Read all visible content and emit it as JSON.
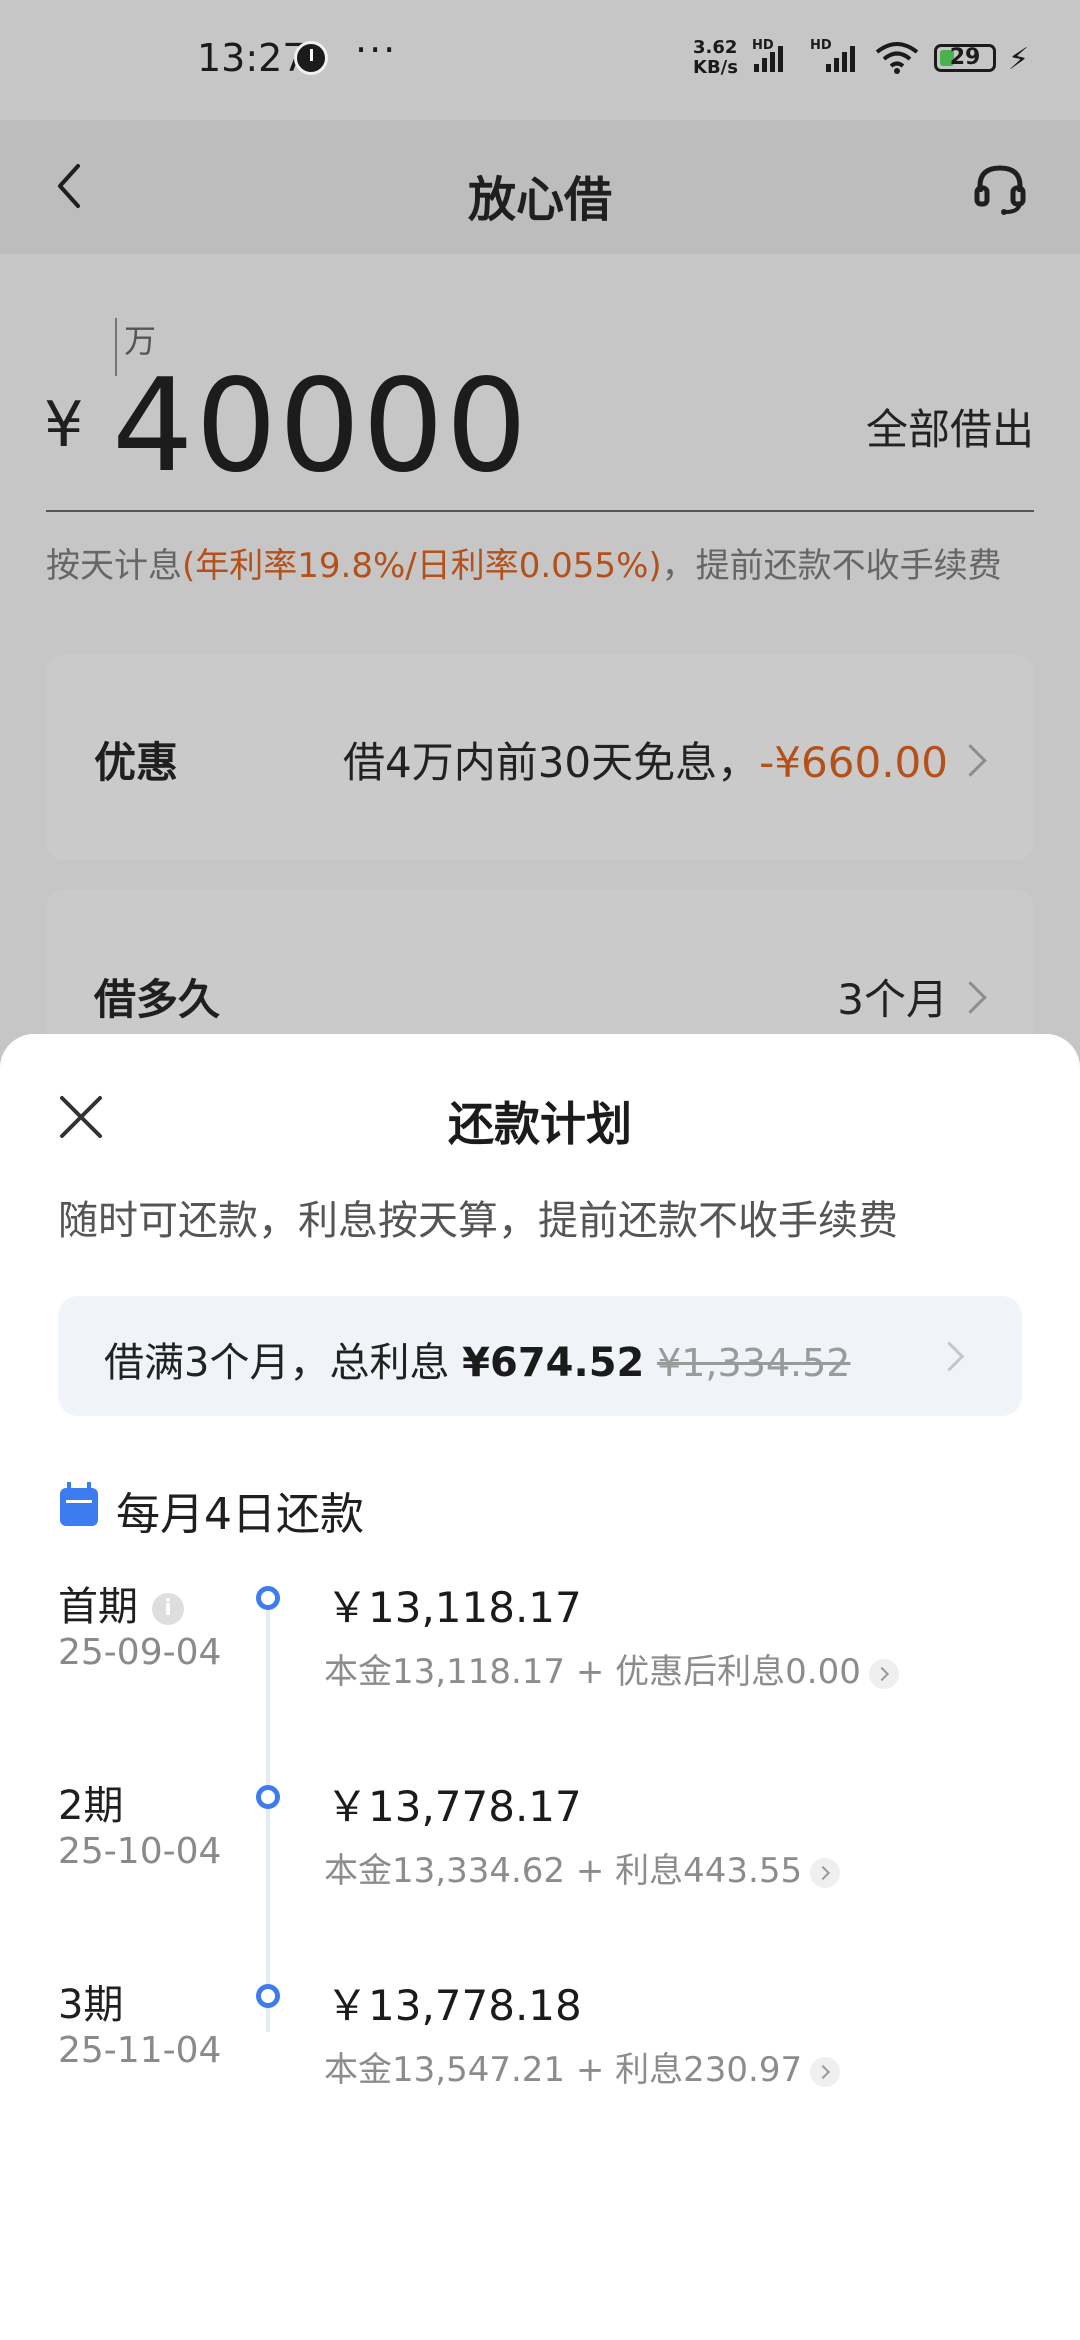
{
  "status_bar": {
    "time": "13:27",
    "dots": "···",
    "net_speed_value": "3.62",
    "net_speed_unit": "KB/s",
    "hd1": "HD",
    "hd2": "HD",
    "battery": "29",
    "battery_level": 0.29
  },
  "nav": {
    "title": "放心借"
  },
  "amount_section": {
    "unit_hint": "万",
    "currency": "¥",
    "amount": "40000",
    "borrow_all": "全部借出",
    "rate_prefix": "按天计息",
    "rate_highlight": "(年利率19.8%/日利率0.055%)",
    "rate_suffix": "，提前还款不收手续费"
  },
  "discount_card": {
    "label": "优惠",
    "value_text": "借4万内前30天免息，",
    "value_amount": "-¥660.00"
  },
  "term_card": {
    "label": "借多久",
    "value": "3个月"
  },
  "sheet": {
    "title": "还款计划",
    "subtitle": "随时可还款，利息按天算，提前还款不收手续费",
    "summary_prefix": "借满3个月，总利息 ",
    "summary_interest": "¥674.52",
    "summary_original": "¥1,334.52",
    "due_label": "每月4日还款",
    "periods": [
      {
        "name": "首期",
        "date": "25-09-04",
        "amount": "￥13,118.17",
        "detail": "本金13,118.17 + 优惠后利息0.00"
      },
      {
        "name": "2期",
        "date": "25-10-04",
        "amount": "￥13,778.17",
        "detail": "本金13,334.62 + 利息443.55"
      },
      {
        "name": "3期",
        "date": "25-11-04",
        "amount": "￥13,778.18",
        "detail": "本金13,547.21 + 利息230.97"
      }
    ]
  },
  "colors": {
    "accent_blue": "#3d7bf0",
    "highlight_orange": "#b4501a"
  },
  "icons": [
    "clock-icon",
    "wifi-icon",
    "battery-icon",
    "back-icon",
    "headset-icon",
    "chevron-right-icon",
    "close-icon",
    "calendar-icon",
    "info-icon"
  ]
}
